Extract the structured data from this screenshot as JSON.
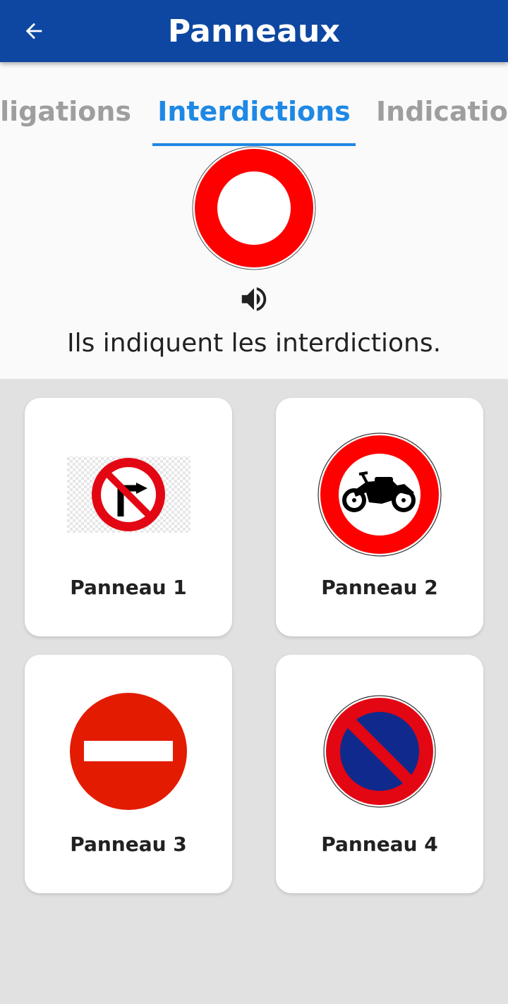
{
  "app_bar": {
    "title": "Panneaux",
    "back_icon": "arrow-back-icon",
    "color": "#0d47a1"
  },
  "tabs": [
    {
      "label": "Obligations",
      "active": false
    },
    {
      "label": "Interdictions",
      "active": true
    },
    {
      "label": "Indications",
      "active": false
    }
  ],
  "category": {
    "sign_icon": "prohibition-sign-icon",
    "audio_icon": "speaker-icon",
    "description": "Ils indiquent les interdictions."
  },
  "signs": [
    {
      "label": "Panneau 1",
      "icon": "no-right-turn-sign-icon"
    },
    {
      "label": "Panneau 2",
      "icon": "no-motorcycles-sign-icon"
    },
    {
      "label": "Panneau 3",
      "icon": "no-entry-sign-icon"
    },
    {
      "label": "Panneau 4",
      "icon": "no-parking-sign-icon"
    }
  ],
  "colors": {
    "accent": "#1e88e5",
    "inactive_tab": "#9e9e9e",
    "sign_red": "#e30613",
    "sign_blue": "#0f2a8c"
  }
}
